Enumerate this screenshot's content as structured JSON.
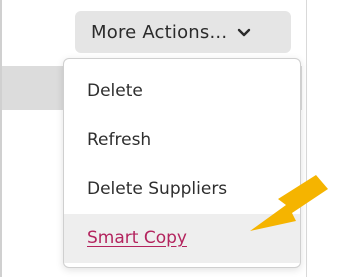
{
  "actions": {
    "button_label": "More Actions...",
    "chevron_icon": "chevron-down-icon"
  },
  "menu": {
    "items": [
      {
        "label": "Delete"
      },
      {
        "label": "Refresh"
      },
      {
        "label": "Delete Suppliers"
      },
      {
        "label": "Smart Copy",
        "highlighted": true
      }
    ]
  },
  "annotation": {
    "arrow_icon": "pointer-arrow-icon",
    "arrow_color": "#f5b400"
  },
  "colors": {
    "highlight_text": "#b3245e",
    "button_bg": "#e5e5e5"
  }
}
